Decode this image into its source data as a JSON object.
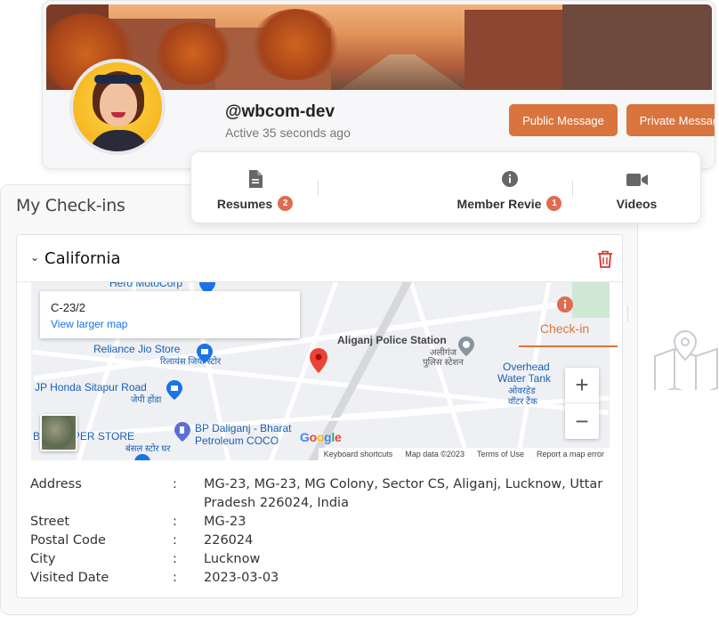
{
  "profile": {
    "username": "@wbcom-dev",
    "status": "Active 35 seconds ago",
    "buttons": {
      "public": "Public Message",
      "private": "Private Message"
    }
  },
  "tabs": [
    {
      "label": "Resumes",
      "icon": "document-icon",
      "badge": "2"
    },
    {
      "label": "Check-in",
      "icon": "info-icon",
      "badge": "",
      "active": true
    },
    {
      "label": "Member Revie",
      "icon": "info-icon",
      "badge": "1"
    },
    {
      "label": "Videos",
      "icon": "video-camera-icon",
      "badge": ""
    }
  ],
  "checkins": {
    "title": "My Check-ins",
    "card": {
      "title": "California",
      "map": {
        "info_title": "C-23/2",
        "info_link": "View larger map",
        "labels": {
          "hero": "Hero MotoCorp",
          "reliance": "Reliance Jio Store",
          "reliance_hi": "रिलायंस जियो स्टोर",
          "honda": "JP Honda Sitapur Road",
          "honda_hi": "जेपी होंडा",
          "super": "B  AL SUPER STORE",
          "super_hi": "बंसल स्टोर घर",
          "bp": "BP Daliganj - Bharat",
          "bp2": "Petroleum COCO",
          "police": "Aliganj Police Station",
          "police_hi": "अलीगंज",
          "police_hi2": "पुलिस स्टेशन",
          "tank": "Overhead",
          "tank2": "Water Tank",
          "tank_hi": "ओवरहेड",
          "tank_hi2": "वॉटर टैंक",
          "google": "Google"
        },
        "footer": [
          "Keyboard shortcuts",
          "Map data ©2023",
          "Terms of Use",
          "Report a map error"
        ]
      },
      "details": [
        {
          "label": "Address",
          "value": "MG-23, MG-23, MG Colony, Sector CS, Aliganj, Lucknow, Uttar Pradesh 226024, India"
        },
        {
          "label": "Street",
          "value": "MG-23"
        },
        {
          "label": "Postal Code",
          "value": "226024"
        },
        {
          "label": "City",
          "value": "Lucknow"
        },
        {
          "label": "Visited Date",
          "value": "2023-03-03"
        }
      ]
    }
  },
  "colors": {
    "accent": "#d9743f",
    "badge": "#e06b4f",
    "trash": "#e0302a"
  }
}
